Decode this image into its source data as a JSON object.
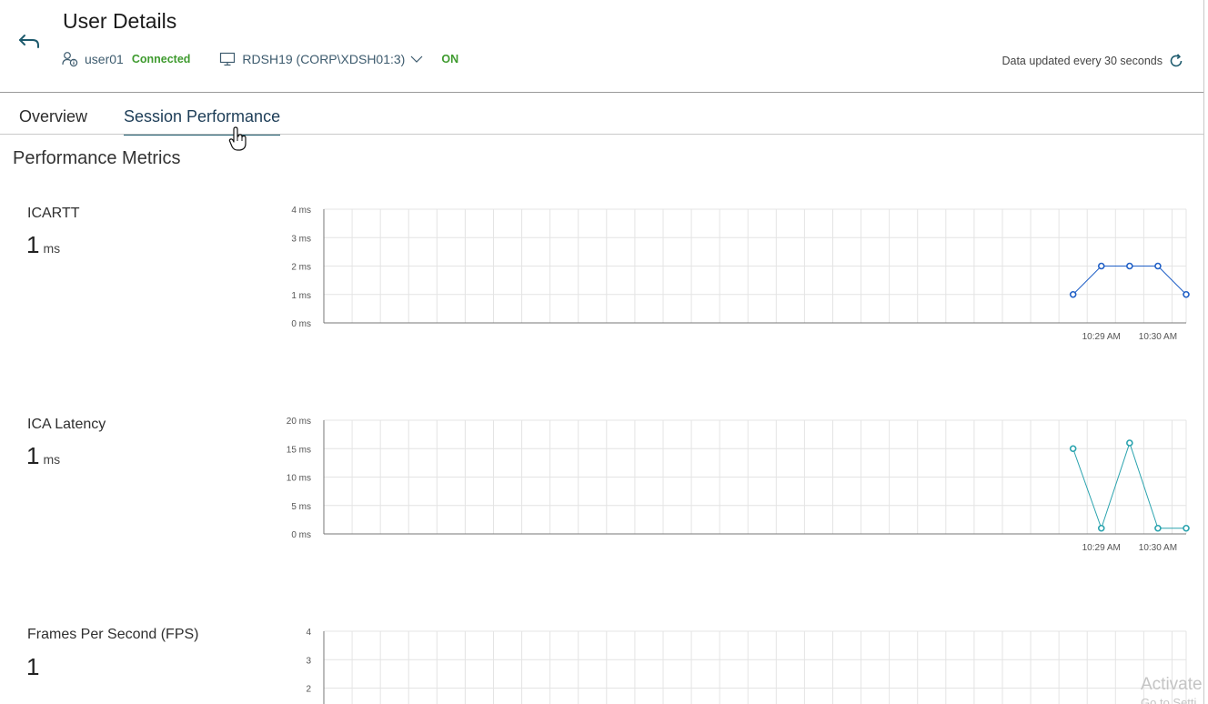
{
  "header": {
    "title": "User Details",
    "user_name": "user01",
    "user_status": "Connected",
    "machine_name": "RDSH19 (CORP\\XDSH01:3)",
    "machine_status": "ON",
    "update_text": "Data updated every 30 seconds"
  },
  "tabs": [
    {
      "label": "Overview",
      "active": false
    },
    {
      "label": "Session Performance",
      "active": true
    }
  ],
  "section_title": "Performance Metrics",
  "metrics": [
    {
      "label": "ICARTT",
      "value": "1",
      "unit": "ms"
    },
    {
      "label": "ICA Latency",
      "value": "1",
      "unit": "ms"
    },
    {
      "label": "Frames Per Second (FPS)",
      "value": "1",
      "unit": ""
    }
  ],
  "colors": {
    "accent": "#1d5a6d",
    "status_green": "#3f9b2f",
    "icartt_line": "#1f5fc6",
    "latency_line": "#2aa3ae",
    "grid": "#e4e4e4"
  },
  "watermark": {
    "line1": "Activate",
    "line2": "Go to Setti"
  },
  "chart_data": [
    {
      "type": "line",
      "series": [
        {
          "values": [
            1,
            2,
            2,
            2,
            1
          ]
        }
      ],
      "point_index": [
        26,
        27,
        28,
        29,
        30
      ],
      "slot_count": 31,
      "yticks": [
        "0 ms",
        "1 ms",
        "2 ms",
        "3 ms",
        "4 ms"
      ],
      "ylim": [
        0,
        4
      ],
      "xtick_labels": [
        {
          "slot": 27,
          "label": "10:29 AM"
        },
        {
          "slot": 29,
          "label": "10:30 AM"
        }
      ],
      "grid": true
    },
    {
      "type": "line",
      "series": [
        {
          "values": [
            15,
            1,
            16,
            1,
            1
          ]
        }
      ],
      "point_index": [
        26,
        27,
        28,
        29,
        30
      ],
      "slot_count": 31,
      "yticks": [
        "0 ms",
        "5 ms",
        "10 ms",
        "15 ms",
        "20 ms"
      ],
      "ylim": [
        0,
        20
      ],
      "xtick_labels": [
        {
          "slot": 27,
          "label": "10:29 AM"
        },
        {
          "slot": 29,
          "label": "10:30 AM"
        }
      ],
      "grid": true
    },
    {
      "type": "line",
      "series": [
        {
          "values": []
        }
      ],
      "point_index": [],
      "slot_count": 31,
      "yticks": [
        "2",
        "3",
        "4"
      ],
      "ytick_values": [
        2,
        3,
        4
      ],
      "ylim": [
        0,
        4
      ],
      "xtick_labels": [],
      "grid": true
    }
  ]
}
